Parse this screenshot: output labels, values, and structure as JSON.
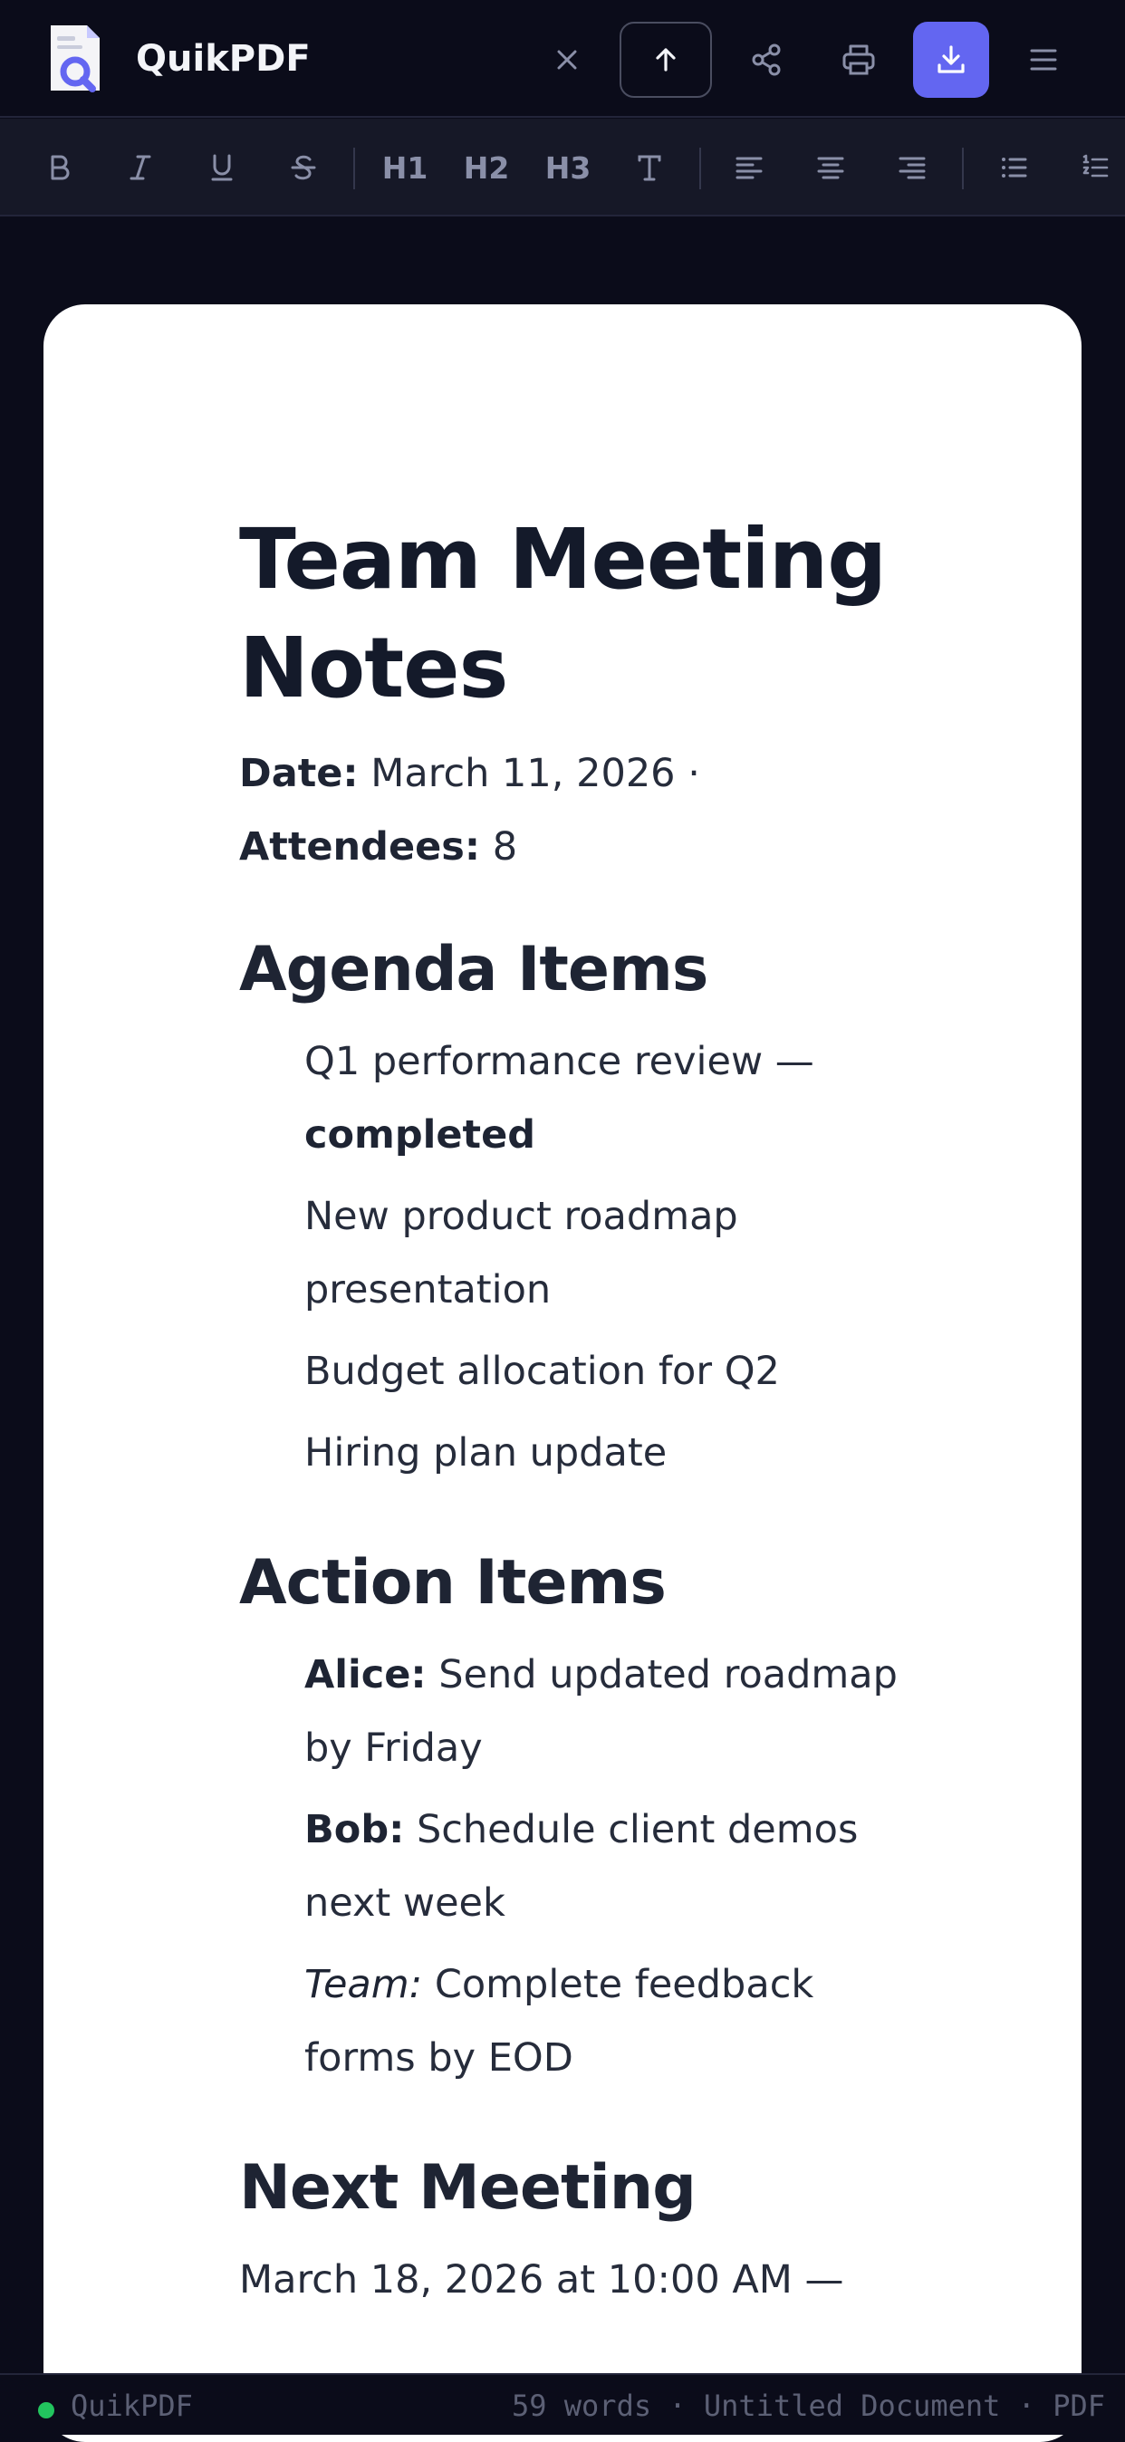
{
  "app": {
    "name": "QuikPDF"
  },
  "toolbar": {
    "close_icon": "close-icon",
    "upload_icon": "arrow-up-icon",
    "share_icon": "share-icon",
    "print_icon": "printer-icon",
    "download_icon": "download-icon",
    "menu_icon": "hamburger-menu-icon",
    "accent": "#6366f1"
  },
  "format": {
    "h1": "H1",
    "h2": "H2",
    "h3": "H3"
  },
  "document": {
    "title": "Team Meeting Notes",
    "meta": {
      "date_label": "Date:",
      "date_value": "March 11, 2026 ·",
      "attendees_label": "Attendees:",
      "attendees_value": "8"
    },
    "agenda": {
      "heading": "Agenda Items",
      "items": [
        {
          "text": "Q1 performance review — ",
          "strong": "completed"
        },
        {
          "text": "New product roadmap presentation"
        },
        {
          "text": "Budget allocation for Q2"
        },
        {
          "text": "Hiring plan update"
        }
      ]
    },
    "actions": {
      "heading": "Action Items",
      "items": [
        {
          "owner": "Alice:",
          "text": "Send updated roadmap by Friday"
        },
        {
          "owner": "Bob:",
          "text": "Schedule client demos next week"
        },
        {
          "owner": "Team:",
          "text": "Complete feedback forms by EOD"
        }
      ]
    },
    "next": {
      "heading": "Next Meeting",
      "text": "March 18, 2026 at 10:00 AM —"
    }
  },
  "status": {
    "app": "QuikPDF",
    "info": "59 words · Untitled Document · PDF",
    "dot_color": "#22c55e"
  }
}
